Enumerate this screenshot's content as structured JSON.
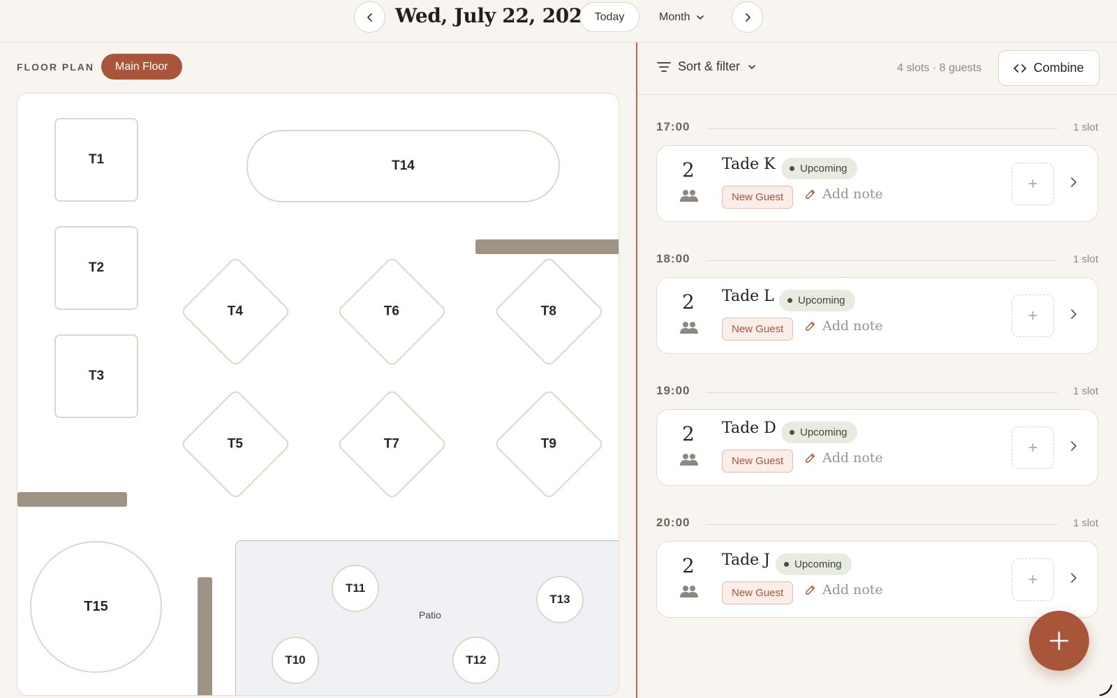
{
  "header": {
    "date_title": "Wed, July 22, 2026",
    "today_label": "Today",
    "view_label": "Month",
    "prev_icon": "chevron-left-icon",
    "next_icon": "chevron-right-icon"
  },
  "floor_plan": {
    "label": "FLOOR PLAN",
    "active_floor": "Main Floor",
    "tables": {
      "t1": "T1",
      "t2": "T2",
      "t3": "T3",
      "t4": "T4",
      "t5": "T5",
      "t6": "T6",
      "t7": "T7",
      "t8": "T8",
      "t9": "T9",
      "t10": "T10",
      "t11": "T11",
      "t12": "T12",
      "t13": "T13",
      "t14": "T14",
      "t15": "T15"
    },
    "patio_label": "Patio"
  },
  "list": {
    "sort_filter_label": "Sort & filter",
    "summary": "4 slots · 8 guests",
    "combine_label": "Combine",
    "slots": [
      {
        "time": "17:00",
        "count": "1 slot",
        "party": "2",
        "name": "Tade K",
        "status": "Upcoming",
        "tag": "New Guest",
        "note": "Add note"
      },
      {
        "time": "18:00",
        "count": "1 slot",
        "party": "2",
        "name": "Tade L",
        "status": "Upcoming",
        "tag": "New Guest",
        "note": "Add note"
      },
      {
        "time": "19:00",
        "count": "1 slot",
        "party": "2",
        "name": "Tade D",
        "status": "Upcoming",
        "tag": "New Guest",
        "note": "Add note"
      },
      {
        "time": "20:00",
        "count": "1 slot",
        "party": "2",
        "name": "Tade J",
        "status": "Upcoming",
        "tag": "New Guest",
        "note": "Add note"
      }
    ]
  },
  "colors": {
    "accent": "#a8553a",
    "background": "#f8f5f0",
    "status_bg": "#e8ebe0",
    "wall": "#9e9385"
  }
}
